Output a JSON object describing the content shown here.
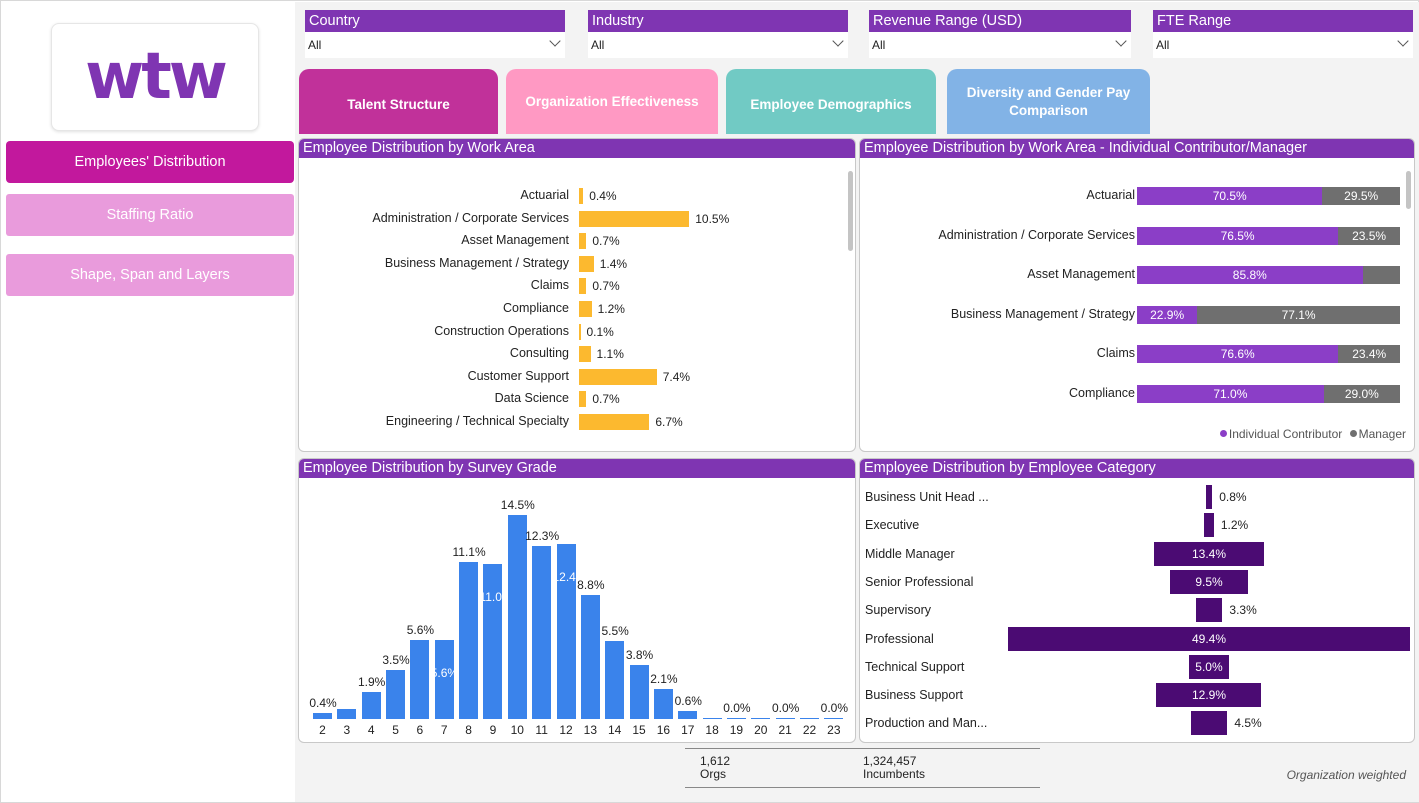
{
  "logo": {
    "text": "wtw"
  },
  "sidebar": {
    "items": [
      {
        "label": "Employees' Distribution",
        "active": true
      },
      {
        "label": "Staffing Ratio"
      },
      {
        "label": "Shape, Span and Layers"
      }
    ]
  },
  "filters": [
    {
      "label": "Country",
      "value": "All"
    },
    {
      "label": "Industry",
      "value": "All"
    },
    {
      "label": "Revenue Range (USD)",
      "value": "All"
    },
    {
      "label": "FTE Range",
      "value": "All"
    }
  ],
  "tabs": [
    {
      "label": "Talent Structure",
      "color": "#c1319a"
    },
    {
      "label": "Organization Effectiveness",
      "color": "#ff99c3"
    },
    {
      "label": "Employee Demographics",
      "color": "#71cac4"
    },
    {
      "label": "Diversity and Gender Pay Comparison",
      "color": "#82b3e6"
    }
  ],
  "colors": {
    "brand_purple": "#7f35b2",
    "bar_yellow": "#fcb92f",
    "ic_purple": "#8b3ec7",
    "manager_gray": "#6f6f6f",
    "grade_blue": "#3a83eb",
    "category_dark": "#4b0b73"
  },
  "panels": {
    "workarea": {
      "title": "Employee Distribution by Work Area"
    },
    "icm": {
      "title": "Employee Distribution by Work Area - Individual Contributor/Manager",
      "legend_ic": "Individual Contributor",
      "legend_mgr": "Manager"
    },
    "grade": {
      "title": "Employee Distribution by Survey Grade"
    },
    "category": {
      "title": "Employee Distribution by Employee Category"
    }
  },
  "chart_data": [
    {
      "type": "bar",
      "orientation": "horizontal",
      "title": "Employee Distribution by Work Area",
      "categories": [
        "Actuarial",
        "Administration / Corporate Services",
        "Asset Management",
        "Business Management / Strategy",
        "Claims",
        "Compliance",
        "Construction Operations",
        "Consulting",
        "Customer Support",
        "Data Science",
        "Engineering / Technical Specialty"
      ],
      "values": [
        0.4,
        10.5,
        0.7,
        1.4,
        0.7,
        1.2,
        0.1,
        1.1,
        7.4,
        0.7,
        6.7
      ],
      "labels": [
        "0.4%",
        "10.5%",
        "0.7%",
        "1.4%",
        "0.7%",
        "1.2%",
        "0.1%",
        "1.1%",
        "7.4%",
        "0.7%",
        "6.7%"
      ]
    },
    {
      "type": "bar",
      "orientation": "horizontal",
      "stacked": "100%",
      "title": "Employee Distribution by Work Area - Individual Contributor/Manager",
      "categories": [
        "Actuarial",
        "Administration / Corporate Services",
        "Asset Management",
        "Business Management / Strategy",
        "Claims",
        "Compliance"
      ],
      "series": [
        {
          "name": "Individual Contributor",
          "values": [
            70.5,
            76.5,
            85.8,
            22.9,
            76.6,
            71.0
          ],
          "labels": [
            "70.5%",
            "76.5%",
            "85.8%",
            "22.9%",
            "76.6%",
            "71.0%"
          ]
        },
        {
          "name": "Manager",
          "values": [
            29.5,
            23.5,
            14.2,
            77.1,
            23.4,
            29.0
          ],
          "labels": [
            "29.5%",
            "23.5%",
            "",
            "77.1%",
            "23.4%",
            "29.0%"
          ]
        }
      ],
      "legend": "bottom-right"
    },
    {
      "type": "bar",
      "title": "Employee Distribution by Survey Grade",
      "categories": [
        "2",
        "3",
        "4",
        "5",
        "6",
        "7",
        "8",
        "9",
        "10",
        "11",
        "12",
        "13",
        "14",
        "15",
        "16",
        "17",
        "18",
        "19",
        "20",
        "21",
        "22",
        "23"
      ],
      "values": [
        0.4,
        0.7,
        1.9,
        3.5,
        5.6,
        5.6,
        11.1,
        11.0,
        14.5,
        12.3,
        12.4,
        8.8,
        5.5,
        3.8,
        2.1,
        0.6,
        0.1,
        0.0,
        0.0,
        0.0,
        0.0,
        0.0
      ],
      "above_labels": {
        "2": "0.4%",
        "4": "1.9%",
        "5": "3.5%",
        "6": "5.6%",
        "8": "11.1%",
        "10": "14.5%",
        "11": "12.3%",
        "13": "8.8%",
        "14": "5.5%",
        "15": "3.8%",
        "16": "2.1%",
        "17": "0.6%",
        "19": "0.0%",
        "21": "0.0%",
        "23": "0.0%"
      },
      "inside_labels": {
        "7": "5.6%",
        "9": "11.0%",
        "12": "12.4%"
      }
    },
    {
      "type": "bar",
      "orientation": "horizontal",
      "style": "funnel",
      "title": "Employee Distribution by Employee Category",
      "categories": [
        "Business Unit Head ...",
        "Executive",
        "Middle Manager",
        "Senior Professional",
        "Supervisory",
        "Professional",
        "Technical Support",
        "Business Support",
        "Production and Man..."
      ],
      "values": [
        0.8,
        1.2,
        13.4,
        9.5,
        3.3,
        49.4,
        5.0,
        12.9,
        4.5
      ],
      "labels": [
        "0.8%",
        "1.2%",
        "13.4%",
        "9.5%",
        "3.3%",
        "49.4%",
        "5.0%",
        "12.9%",
        "4.5%"
      ]
    }
  ],
  "footer": {
    "orgs_value": "1,612",
    "orgs_label": "Orgs",
    "incumbents_value": "1,324,457",
    "incumbents_label": "Incumbents",
    "note": "Organization weighted"
  }
}
